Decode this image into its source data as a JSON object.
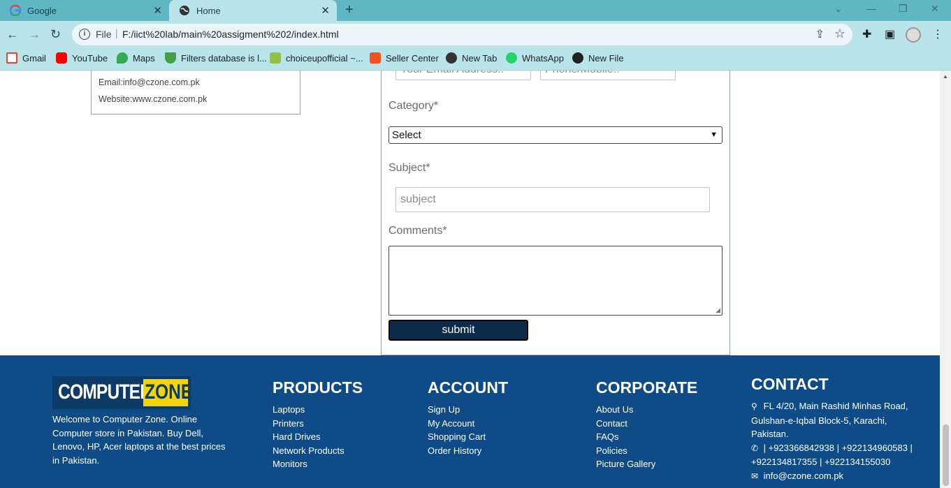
{
  "browser": {
    "tabs": [
      {
        "title": "Google",
        "favicon": "google-g-icon"
      },
      {
        "title": "Home",
        "favicon": "globe-icon"
      }
    ],
    "address": {
      "scheme": "File",
      "url": "F:/iict%20lab/main%20assigment%202/index.html"
    },
    "bookmarks": [
      {
        "label": "Gmail",
        "icon": "gmail-icon",
        "color": "#ea4335"
      },
      {
        "label": "YouTube",
        "icon": "youtube-icon",
        "color": "#ff0000"
      },
      {
        "label": "Maps",
        "icon": "maps-icon",
        "color": "#34a853"
      },
      {
        "label": "Filters database is l...",
        "icon": "shield-check-icon",
        "color": "#43a047"
      },
      {
        "label": "choiceupofficial ~...",
        "icon": "shopify-icon",
        "color": "#95bf47"
      },
      {
        "label": "Seller Center",
        "icon": "seller-center-icon",
        "color": "#f4511e"
      },
      {
        "label": "New Tab",
        "icon": "globe-icon",
        "color": "#333333"
      },
      {
        "label": "WhatsApp",
        "icon": "whatsapp-icon",
        "color": "#25d366"
      },
      {
        "label": "New File",
        "icon": "github-icon",
        "color": "#222222"
      }
    ]
  },
  "address_box": {
    "email": "Email:info@czone.com.pk",
    "website": "Website:www.czone.com.pk"
  },
  "form": {
    "email_placeholder": "Your Email Address..",
    "phone_placeholder": "Phone/Mobile..",
    "category_label": "Category*",
    "category_selected": "Select",
    "subject_label": "Subject*",
    "subject_placeholder": "subject",
    "comments_label": "Comments*",
    "submit_label": "submit"
  },
  "footer": {
    "logo": {
      "left": "COMPUTER",
      "right": "ZONE"
    },
    "about": "Welcome to Computer Zone. Online Computer store in Pakistan. Buy Dell, Lenovo, HP, Acer laptops at the best prices in Pakistan.",
    "products": {
      "heading": "PRODUCTS",
      "items": [
        "Laptops",
        "Printers",
        "Hard Drives",
        "Network Products",
        "Monitors"
      ]
    },
    "account": {
      "heading": "ACCOUNT",
      "items": [
        "Sign Up",
        "My Account",
        "Shopping Cart",
        "Order History"
      ]
    },
    "corporate": {
      "heading": "CORPORATE",
      "items": [
        "About Us",
        "Contact",
        "FAQs",
        "Policies",
        "Picture Gallery"
      ]
    },
    "contact": {
      "heading": "CONTACT",
      "address": "FL 4/20, Main Rashid Minhas Road, Gulshan-e-Iqbal Block-5, Karachi, Pakistan.",
      "phones": "| +923366842938 | +922134960583 | +922134817355 | +922134155030",
      "email": "info@czone.com.pk"
    }
  },
  "colors": {
    "footer_bg": "#0f4c87",
    "submit_bg": "#0c2b4a",
    "logo_yellow": "#f4d50b",
    "chrome_teal": "#5fb7c4"
  }
}
